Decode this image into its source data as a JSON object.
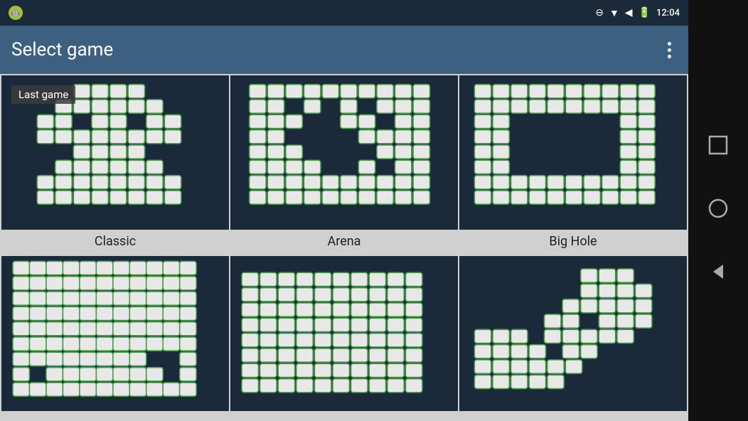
{
  "statusBar": {
    "time": "12:04",
    "icons": [
      "minus-circle",
      "wifi",
      "signal",
      "battery"
    ]
  },
  "appBar": {
    "title": "Select game",
    "menuIcon": "more-vert"
  },
  "games": [
    {
      "id": "classic",
      "label": "Classic",
      "isLastGame": true,
      "lastGameLabel": "Last game"
    },
    {
      "id": "arena",
      "label": "Arena",
      "isLastGame": false,
      "lastGameLabel": ""
    },
    {
      "id": "big-hole",
      "label": "Big Hole",
      "isLastGame": false,
      "lastGameLabel": ""
    },
    {
      "id": "spiral",
      "label": "",
      "isLastGame": false,
      "lastGameLabel": ""
    },
    {
      "id": "flat",
      "label": "",
      "isLastGame": false,
      "lastGameLabel": ""
    },
    {
      "id": "pattern",
      "label": "",
      "isLastGame": false,
      "lastGameLabel": ""
    }
  ],
  "navBar": {
    "icons": [
      "square",
      "circle",
      "triangle-left"
    ]
  }
}
